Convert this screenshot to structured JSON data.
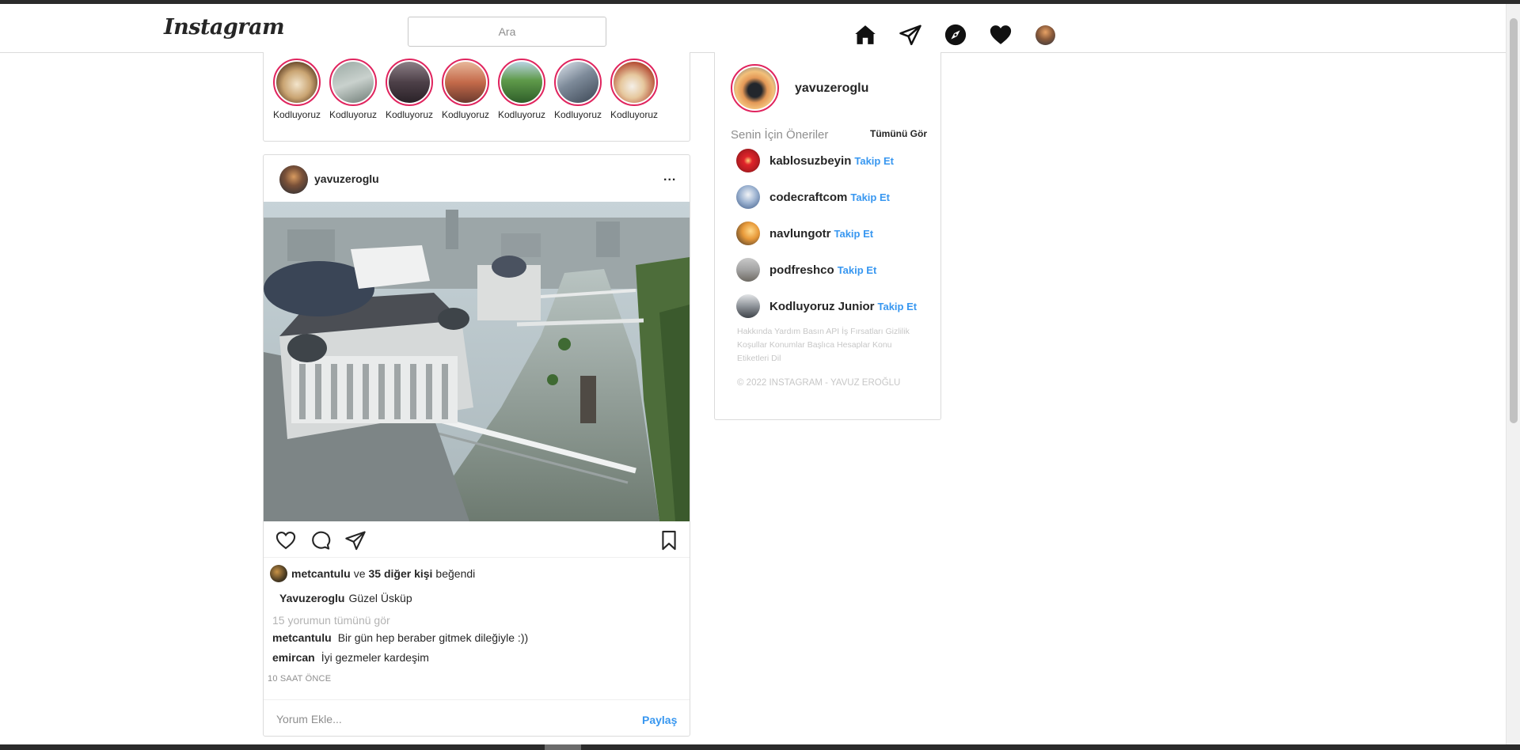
{
  "navbar": {
    "logo": "Instagram",
    "search_placeholder": "Ara"
  },
  "stories": [
    {
      "label": "Kodluyoruz"
    },
    {
      "label": "Kodluyoruz"
    },
    {
      "label": "Kodluyoruz"
    },
    {
      "label": "Kodluyoruz"
    },
    {
      "label": "Kodluyoruz"
    },
    {
      "label": "Kodluyoruz"
    },
    {
      "label": "Kodluyoruz"
    }
  ],
  "post": {
    "username": "yavuzeroglu",
    "more": "...",
    "likes": {
      "user": "metcantulu",
      "and": "ve",
      "others": "35 diğer kişi",
      "suffix": "beğendi"
    },
    "caption": {
      "user": "Yavuzeroglu",
      "text": "Güzel Üsküp"
    },
    "view_all_comments": "15 yorumun tümünü gör",
    "comments": [
      {
        "user": "metcantulu",
        "text": "Bir gün hep beraber gitmek dileğiyle :))"
      },
      {
        "user": "emircan",
        "text": "İyi gezmeler kardeşim"
      }
    ],
    "time": "10 SAAT ÖNCE",
    "comment_placeholder": "Yorum Ekle...",
    "share_label": "Paylaş"
  },
  "sidebar": {
    "username": "yavuzeroglu",
    "suggestions_title": "Senin İçin Öneriler",
    "see_all": "Tümünü Gör",
    "suggestions": [
      {
        "name": "kablosuzbeyin",
        "follow": "Takip Et"
      },
      {
        "name": "codecraftcom",
        "follow": "Takip Et"
      },
      {
        "name": "navlungotr",
        "follow": "Takip Et"
      },
      {
        "name": "podfreshco",
        "follow": "Takip Et"
      },
      {
        "name": "Kodluyoruz Junior",
        "follow": "Takip Et"
      }
    ],
    "footer_links": "Hakkında Yardım Basın API İş Fırsatları Gizlilik Koşullar Konumlar Başlıca Hesaplar Konu Etiketleri Dil",
    "copyright": "© 2022 INSTAGRAM - YAVUZ EROĞLU"
  },
  "colors": {
    "accent": "#3897f0",
    "story_ring": "#e0245e",
    "border": "#dbdbdb",
    "muted": "#8e8e8e"
  },
  "icons": {
    "nav": [
      "home-icon",
      "direct-message-icon",
      "explore-icon",
      "activity-heart-icon",
      "profile-avatar"
    ],
    "post_actions": [
      "like-heart-icon",
      "comment-icon",
      "share-icon",
      "bookmark-icon"
    ]
  }
}
